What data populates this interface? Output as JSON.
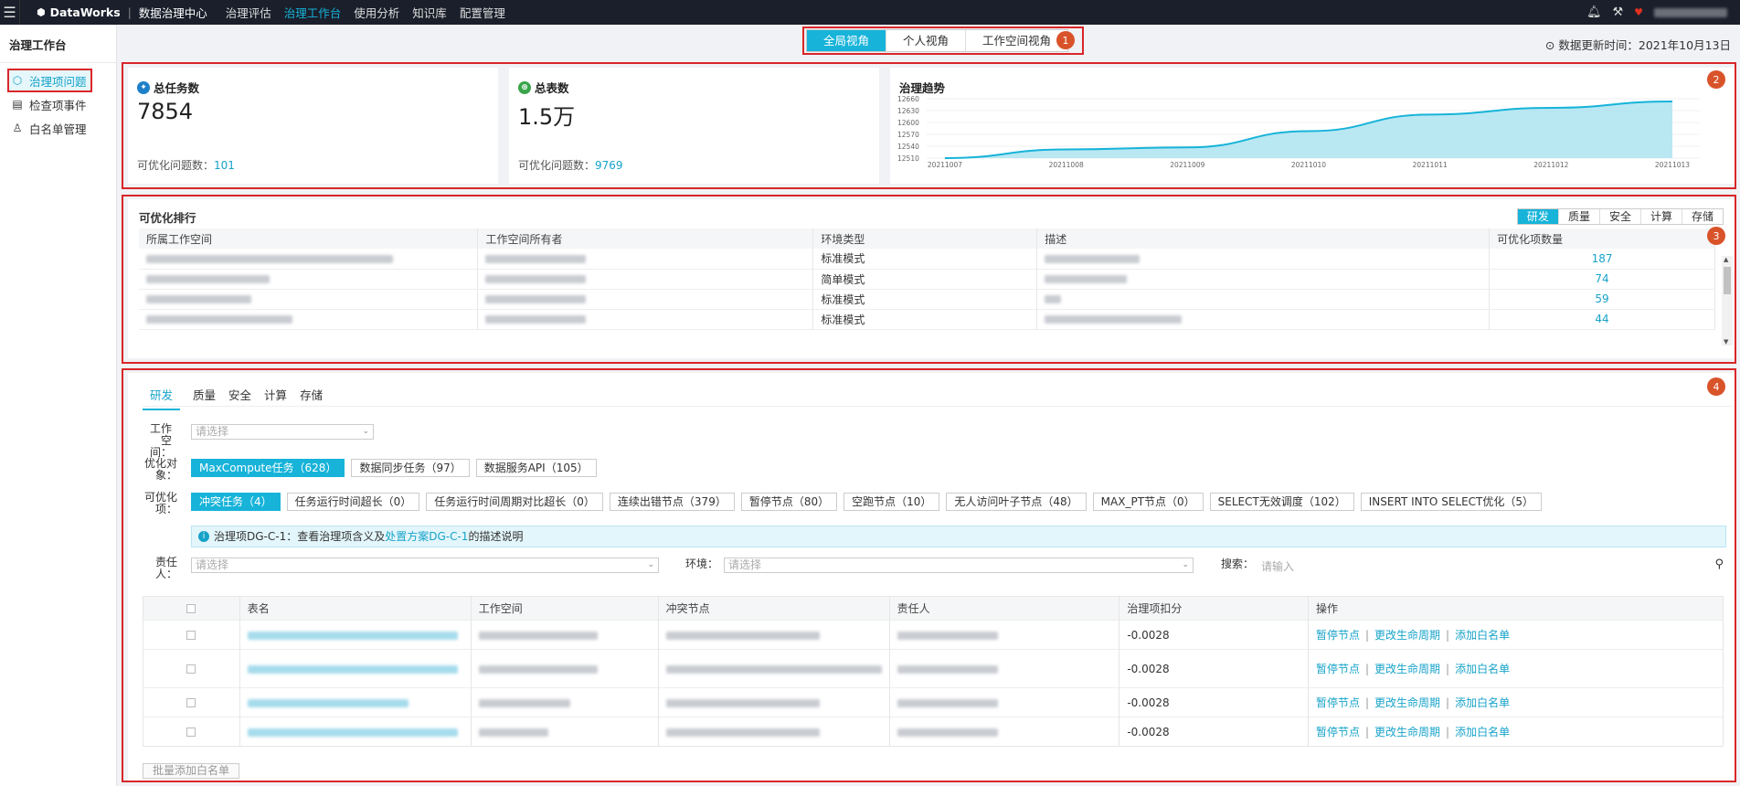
{
  "topbar": {
    "brand": "DataWorks",
    "app": "数据治理中心",
    "nav": [
      "治理评估",
      "治理工作台",
      "使用分析",
      "知识库",
      "配置管理"
    ],
    "active_nav": 1
  },
  "sidebar": {
    "title": "治理工作台",
    "items": [
      {
        "label": "治理项问题",
        "icon": "governance-icon"
      },
      {
        "label": "检查项事件",
        "icon": "check-event-icon"
      },
      {
        "label": "白名单管理",
        "icon": "user-icon"
      }
    ]
  },
  "view_tabs": [
    "全局视角",
    "个人视角",
    "工作空间视角"
  ],
  "update_time": "数据更新时间：2021年10月13日",
  "badges": [
    "1",
    "2",
    "3",
    "4"
  ],
  "cards": {
    "tasks": {
      "title": "总任务数",
      "value": "7854",
      "sub_label": "可优化问题数：",
      "sub_value": "101"
    },
    "tables": {
      "title": "总表数",
      "value": "1.5万",
      "sub_label": "可优化问题数：",
      "sub_value": "9769"
    },
    "trend": {
      "title": "治理趋势"
    }
  },
  "chart_data": {
    "type": "area",
    "title": "治理趋势",
    "x": [
      "20211007",
      "20211008",
      "20211009",
      "20211010",
      "20211011",
      "20211012",
      "20211013"
    ],
    "values": [
      12510,
      12532,
      12537,
      12578,
      12620,
      12637,
      12653
    ],
    "yticks": [
      "12660",
      "12630",
      "12600",
      "12570",
      "12540",
      "12510"
    ],
    "ylim": [
      12510,
      12660
    ],
    "color": "#17b3d9",
    "fill": "#a8e2f0"
  },
  "ranking": {
    "title": "可优化排行",
    "tabs": [
      "研发",
      "质量",
      "安全",
      "计算",
      "存储"
    ],
    "headers": [
      "所属工作空间",
      "工作空间所有者",
      "环境类型",
      "描述",
      "可优化项数量"
    ],
    "rows": [
      {
        "env": "标准模式",
        "count": "187"
      },
      {
        "env": "简单模式",
        "count": "74"
      },
      {
        "env": "标准模式",
        "count": "59"
      },
      {
        "env": "标准模式",
        "count": "44"
      }
    ]
  },
  "detail": {
    "tabs": [
      "研发",
      "质量",
      "安全",
      "计算",
      "存储"
    ],
    "workspace_label": "工作空间：",
    "workspace_placeholder": "请选择",
    "object_label": "优化对象：",
    "objects": [
      "MaxCompute任务（628）",
      "数据同步任务（97）",
      "数据服务API（105）"
    ],
    "item_label": "可优化项：",
    "items": [
      "冲突任务（4）",
      "任务运行时间超长（0）",
      "任务运行时间周期对比超长（0）",
      "连续出错节点（379）",
      "暂停节点（80）",
      "空跑节点（10）",
      "无人访问叶子节点（48）",
      "MAX_PT节点（0）",
      "SELECT无效调度（102）",
      "INSERT INTO SELECT优化（5）"
    ],
    "info_prefix": "治理项DG-C-1：查看治理项含义及",
    "info_link": "处置方案DG-C-1",
    "info_suffix": "的描述说明",
    "owner_label": "责任人：",
    "owner_placeholder": "请选择",
    "env_label": "环境：",
    "env_placeholder": "请选择",
    "search_label": "搜索：",
    "search_placeholder": "请输入",
    "headers": [
      "表名",
      "工作空间",
      "冲突节点",
      "责任人",
      "治理项扣分",
      "操作"
    ],
    "rows": [
      {
        "score": "-0.0028"
      },
      {
        "score": "-0.0028"
      },
      {
        "score": "-0.0028"
      },
      {
        "score": "-0.0028"
      }
    ],
    "ops": [
      "暂停节点",
      "更改生命周期",
      "添加白名单"
    ],
    "batch_label": "批量添加白名单"
  }
}
